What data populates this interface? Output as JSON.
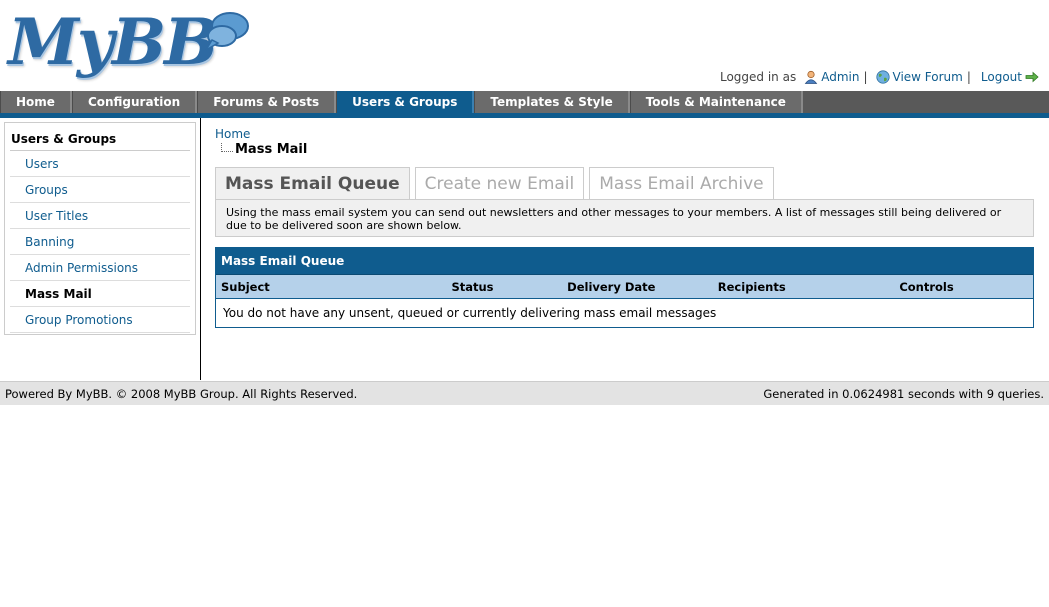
{
  "logo": {
    "text": "MyBB"
  },
  "user_bar": {
    "logged_in_label": "Logged in as",
    "username": "Admin",
    "view_forum": "View Forum",
    "logout": "Logout",
    "separator": "|"
  },
  "nav": {
    "tabs": [
      {
        "label": "Home"
      },
      {
        "label": "Configuration"
      },
      {
        "label": "Forums & Posts"
      },
      {
        "label": "Users & Groups",
        "active": true
      },
      {
        "label": "Templates & Style"
      },
      {
        "label": "Tools & Maintenance"
      }
    ]
  },
  "sidebar": {
    "title": "Users & Groups",
    "items": [
      {
        "label": "Users"
      },
      {
        "label": "Groups"
      },
      {
        "label": "User Titles"
      },
      {
        "label": "Banning"
      },
      {
        "label": "Admin Permissions"
      },
      {
        "label": "Mass Mail",
        "active": true
      },
      {
        "label": "Group Promotions"
      }
    ]
  },
  "breadcrumb": {
    "home": "Home",
    "current": "Mass Mail"
  },
  "tabs": [
    {
      "label": "Mass Email Queue",
      "active": true
    },
    {
      "label": "Create new Email"
    },
    {
      "label": "Mass Email Archive"
    }
  ],
  "description": "Using the mass email system you can send out newsletters and other messages to your members. A list of messages still being delivered or due to be delivered soon are shown below.",
  "table": {
    "title": "Mass Email Queue",
    "columns": [
      "Subject",
      "Status",
      "Delivery Date",
      "Recipients",
      "Controls"
    ],
    "empty_message": "You do not have any unsent, queued or currently delivering mass email messages"
  },
  "footer": {
    "left": "Powered By MyBB. © 2008 MyBB Group. All Rights Reserved.",
    "right": "Generated in 0.0624981 seconds with 9 queries."
  },
  "colors": {
    "brand": "#0f5c8e",
    "nav_bg": "#595959",
    "table_head": "#b5d1ea"
  }
}
